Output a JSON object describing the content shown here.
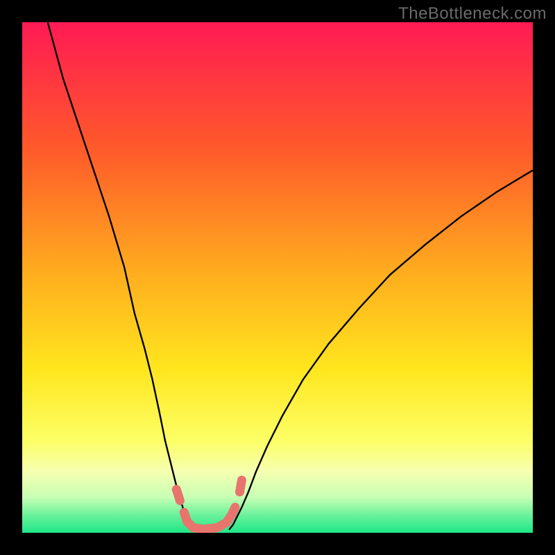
{
  "watermark": "TheBottleneck.com",
  "chart_data": {
    "type": "line",
    "title": "",
    "xlabel": "",
    "ylabel": "",
    "xlim": [
      0,
      100
    ],
    "ylim": [
      0,
      100
    ],
    "grid": false,
    "legend": false,
    "background_gradient": {
      "stops": [
        {
          "pos": 0.0,
          "color": "#ff1a54"
        },
        {
          "pos": 0.25,
          "color": "#ff5a2a"
        },
        {
          "pos": 0.5,
          "color": "#ffb01e"
        },
        {
          "pos": 0.68,
          "color": "#ffe61e"
        },
        {
          "pos": 0.82,
          "color": "#fcff66"
        },
        {
          "pos": 0.88,
          "color": "#f6ffb0"
        },
        {
          "pos": 0.93,
          "color": "#c8ffb4"
        },
        {
          "pos": 0.965,
          "color": "#6cf29b"
        },
        {
          "pos": 1.0,
          "color": "#1ee688"
        }
      ]
    },
    "series": [
      {
        "name": "left-curve",
        "stroke": "#000000",
        "x": [
          5,
          8,
          11,
          14,
          17,
          20,
          22,
          24,
          25.5,
          27,
          28,
          29,
          30,
          30.8,
          31.6,
          32.4,
          33.2,
          34
        ],
        "y": [
          100,
          89,
          80,
          71,
          62,
          52,
          43,
          36,
          30,
          23,
          18,
          14,
          10,
          7,
          4.5,
          2.8,
          1.5,
          0.6
        ]
      },
      {
        "name": "right-curve",
        "stroke": "#000000",
        "x": [
          40.5,
          41.3,
          42,
          43,
          44.3,
          45.8,
          48,
          51,
          55,
          60,
          66,
          72,
          79,
          86,
          93,
          100
        ],
        "y": [
          0.6,
          1.6,
          3,
          5,
          8,
          12,
          17,
          23,
          30,
          37,
          44,
          50.5,
          56.5,
          62,
          66.8,
          71
        ]
      },
      {
        "name": "bottom-bridge",
        "stroke": "#e8746e",
        "stroke_width": 13,
        "linecap": "round",
        "x": [
          31.7,
          32.3,
          33.5,
          35.5,
          38.2,
          40.0,
          41.0,
          41.7
        ],
        "y": [
          4.0,
          2.2,
          1.0,
          0.7,
          1.0,
          2.0,
          3.5,
          5.0
        ]
      },
      {
        "name": "bottom-bridge-dot-left",
        "stroke": "#e8746e",
        "stroke_width": 13,
        "linecap": "round",
        "x": [
          30.2,
          30.9
        ],
        "y": [
          8.5,
          6.3
        ]
      },
      {
        "name": "bottom-bridge-dot-right",
        "stroke": "#e8746e",
        "stroke_width": 13,
        "linecap": "round",
        "x": [
          42.6,
          43.0
        ],
        "y": [
          8.0,
          10.3
        ]
      }
    ]
  }
}
